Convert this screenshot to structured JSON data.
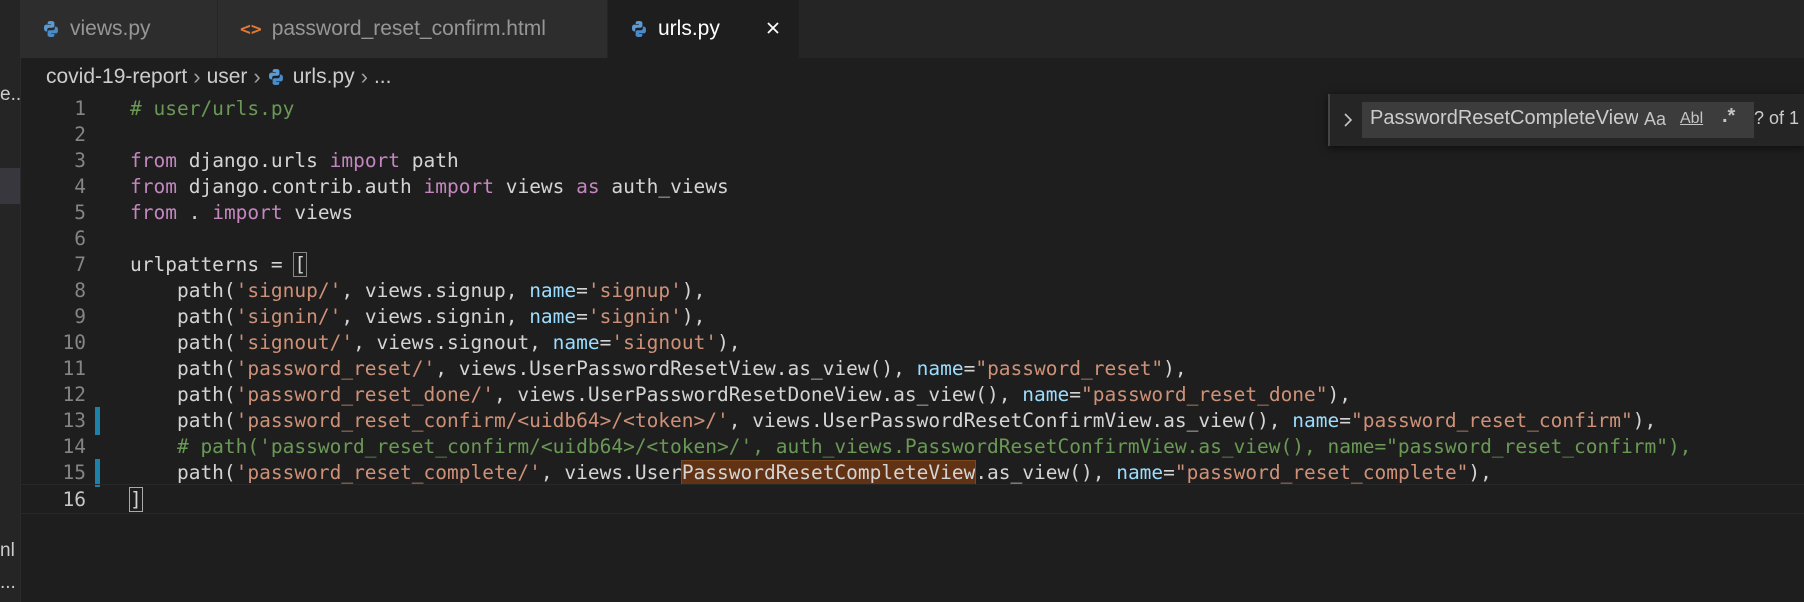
{
  "tabs": [
    {
      "label": "views.py",
      "icon": "python-icon",
      "active": false
    },
    {
      "label": "password_reset_confirm.html",
      "icon": "html-icon",
      "active": false
    },
    {
      "label": "urls.py",
      "icon": "python-icon",
      "active": true
    }
  ],
  "breadcrumb": {
    "items": [
      "covid-19-report",
      "user",
      "urls.py",
      "..."
    ]
  },
  "left_strip": {
    "fragment_1": "e...",
    "fragment_2": "nl",
    "fragment_3": "..."
  },
  "find_widget": {
    "value": "PasswordResetCompleteView",
    "opt_case": "Aa",
    "opt_word": "Abl",
    "opt_regex": ".*",
    "count": "? of 1"
  },
  "editor": {
    "line_numbers": [
      "1",
      "2",
      "3",
      "4",
      "5",
      "6",
      "7",
      "8",
      "9",
      "10",
      "11",
      "12",
      "13",
      "14",
      "15",
      "16"
    ],
    "lines": [
      [
        {
          "t": "# user/urls.py",
          "c": "cm"
        }
      ],
      [],
      [
        {
          "t": "from",
          "c": "kw"
        },
        {
          "t": " django.urls ",
          "c": "def"
        },
        {
          "t": "import",
          "c": "kw"
        },
        {
          "t": " path",
          "c": "def"
        }
      ],
      [
        {
          "t": "from",
          "c": "kw"
        },
        {
          "t": " django.contrib.auth ",
          "c": "def"
        },
        {
          "t": "import",
          "c": "kw"
        },
        {
          "t": " views ",
          "c": "def"
        },
        {
          "t": "as",
          "c": "kw"
        },
        {
          "t": " auth_views",
          "c": "def"
        }
      ],
      [
        {
          "t": "from",
          "c": "kw"
        },
        {
          "t": " . ",
          "c": "def"
        },
        {
          "t": "import",
          "c": "kw"
        },
        {
          "t": " views",
          "c": "def"
        }
      ],
      [],
      [
        {
          "t": "urlpatterns = ",
          "c": "def"
        },
        {
          "t": "[",
          "c": "def bracket-box"
        }
      ],
      [
        {
          "t": "    path(",
          "c": "def"
        },
        {
          "t": "'signup/'",
          "c": "str"
        },
        {
          "t": ", views.signup, ",
          "c": "def"
        },
        {
          "t": "name",
          "c": "prm"
        },
        {
          "t": "=",
          "c": "def"
        },
        {
          "t": "'signup'",
          "c": "str"
        },
        {
          "t": "),",
          "c": "def"
        }
      ],
      [
        {
          "t": "    path(",
          "c": "def"
        },
        {
          "t": "'signin/'",
          "c": "str"
        },
        {
          "t": ", views.signin, ",
          "c": "def"
        },
        {
          "t": "name",
          "c": "prm"
        },
        {
          "t": "=",
          "c": "def"
        },
        {
          "t": "'signin'",
          "c": "str"
        },
        {
          "t": "),",
          "c": "def"
        }
      ],
      [
        {
          "t": "    path(",
          "c": "def"
        },
        {
          "t": "'signout/'",
          "c": "str"
        },
        {
          "t": ", views.signout, ",
          "c": "def"
        },
        {
          "t": "name",
          "c": "prm"
        },
        {
          "t": "=",
          "c": "def"
        },
        {
          "t": "'signout'",
          "c": "str"
        },
        {
          "t": "),",
          "c": "def"
        }
      ],
      [
        {
          "t": "    path(",
          "c": "def"
        },
        {
          "t": "'password_reset/'",
          "c": "str"
        },
        {
          "t": ", views.UserPasswordResetView.as_view(), ",
          "c": "def"
        },
        {
          "t": "name",
          "c": "prm"
        },
        {
          "t": "=",
          "c": "def"
        },
        {
          "t": "\"password_reset\"",
          "c": "str"
        },
        {
          "t": "),",
          "c": "def"
        }
      ],
      [
        {
          "t": "    path(",
          "c": "def"
        },
        {
          "t": "'password_reset_done/'",
          "c": "str"
        },
        {
          "t": ", views.UserPasswordResetDoneView.as_view(), ",
          "c": "def"
        },
        {
          "t": "name",
          "c": "prm"
        },
        {
          "t": "=",
          "c": "def"
        },
        {
          "t": "\"password_reset_done\"",
          "c": "str"
        },
        {
          "t": "),",
          "c": "def"
        }
      ],
      [
        {
          "t": "    path(",
          "c": "def"
        },
        {
          "t": "'password_reset_confirm/<uidb64>/<token>/'",
          "c": "str"
        },
        {
          "t": ", views.UserPasswordResetConfirmView.as_view(), ",
          "c": "def"
        },
        {
          "t": "name",
          "c": "prm"
        },
        {
          "t": "=",
          "c": "def"
        },
        {
          "t": "\"password_reset_confirm\"",
          "c": "str"
        },
        {
          "t": "),",
          "c": "def"
        }
      ],
      [
        {
          "t": "    # path('password_reset_confirm/<uidb64>/<token>/', auth_views.PasswordResetConfirmView.as_view(), name=\"password_reset_confirm\"),",
          "c": "cm"
        }
      ],
      [
        {
          "t": "    path(",
          "c": "def"
        },
        {
          "t": "'password_reset_complete/'",
          "c": "str"
        },
        {
          "t": ", views.User",
          "c": "def"
        },
        {
          "t": "PasswordResetCompleteView",
          "c": "def match"
        },
        {
          "t": ".as_view(), ",
          "c": "def"
        },
        {
          "t": "name",
          "c": "prm"
        },
        {
          "t": "=",
          "c": "def"
        },
        {
          "t": "\"password_reset_complete\"",
          "c": "str"
        },
        {
          "t": "),",
          "c": "def"
        }
      ],
      [
        {
          "t": "]",
          "c": "def cursor-box"
        }
      ]
    ]
  },
  "colors": {
    "background": "#1e1e1e",
    "keyword": "#c586c0",
    "string": "#ce9178",
    "comment": "#6a9955",
    "param": "#9cdcfe",
    "match_highlight": "#613214",
    "modified_gutter": "#1b81a8"
  }
}
